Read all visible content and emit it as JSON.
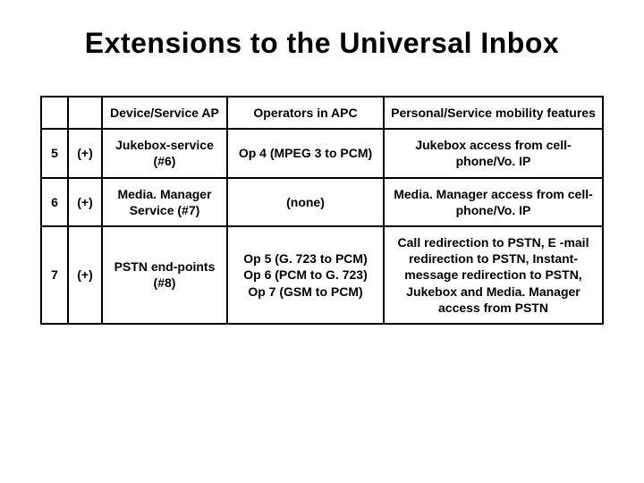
{
  "title": "Extensions to the Universal Inbox",
  "headers": {
    "c1": "",
    "c2": "",
    "c3": "Device/Service AP",
    "c4": "Operators in APC",
    "c5": "Personal/Service mobility features"
  },
  "rows": [
    {
      "num": "5",
      "mark": "(+)",
      "device": "Jukebox-service (#6)",
      "ops": [
        "Op 4 (MPEG 3 to PCM)"
      ],
      "features": "Jukebox access from cell-phone/Vo. IP"
    },
    {
      "num": "6",
      "mark": "(+)",
      "device": "Media. Manager Service (#7)",
      "ops": [
        "(none)"
      ],
      "features": "Media. Manager access from cell-phone/Vo. IP"
    },
    {
      "num": "7",
      "mark": "(+)",
      "device": "PSTN end-points (#8)",
      "ops": [
        "Op 5 (G. 723 to PCM)",
        "Op 6 (PCM to G. 723)",
        "Op 7 (GSM to PCM)"
      ],
      "features": "Call redirection to PSTN, E -mail redirection to PSTN, Instant-message redirection to PSTN, Jukebox and Media. Manager access from PSTN"
    }
  ],
  "chart_data": {
    "type": "table",
    "title": "Extensions to the Universal Inbox",
    "columns": [
      "#",
      "",
      "Device/Service AP",
      "Operators in APC",
      "Personal/Service mobility features"
    ],
    "rows": [
      [
        "5",
        "(+)",
        "Jukebox-service (#6)",
        "Op 4 (MPEG 3 to PCM)",
        "Jukebox access from cell-phone/Vo. IP"
      ],
      [
        "6",
        "(+)",
        "Media. Manager Service (#7)",
        "(none)",
        "Media. Manager access from cell-phone/Vo. IP"
      ],
      [
        "7",
        "(+)",
        "PSTN end-points (#8)",
        "Op 5 (G. 723 to PCM); Op 6 (PCM to G. 723); Op 7 (GSM to PCM)",
        "Call redirection to PSTN, E-mail redirection to PSTN, Instant-message redirection to PSTN, Jukebox and Media. Manager access from PSTN"
      ]
    ]
  }
}
